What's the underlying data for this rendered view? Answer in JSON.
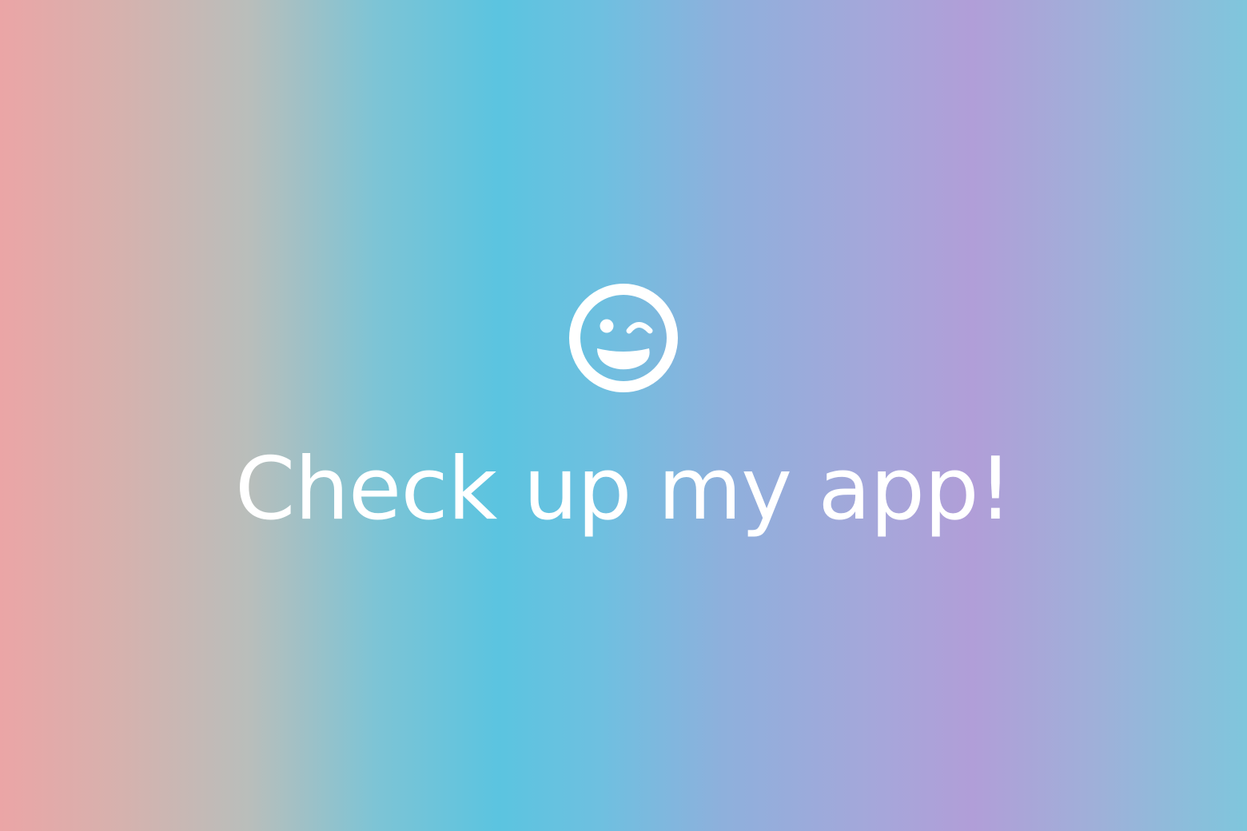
{
  "screen": {
    "icon": "winking-smiley-icon",
    "title": "Check up my app!",
    "colors": {
      "text": "#ffffff",
      "icon": "#ffffff",
      "gradient": [
        "#eba5a6",
        "#b9bebb",
        "#5bc4e0",
        "#b19ed8",
        "#7fc6dc"
      ]
    }
  }
}
